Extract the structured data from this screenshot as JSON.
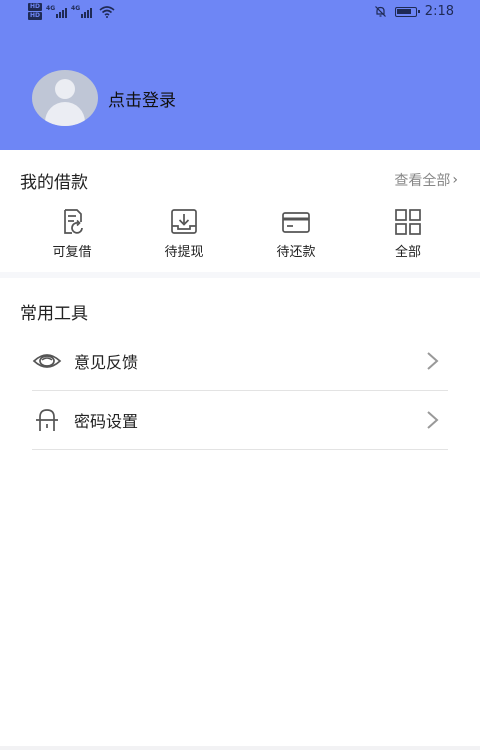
{
  "status_bar": {
    "badges": [
      "HD",
      "HD"
    ],
    "network": [
      "4G",
      "4G"
    ],
    "time": "2:18"
  },
  "profile": {
    "login_text": "点击登录"
  },
  "loans": {
    "title": "我的借款",
    "view_all": "查看全部",
    "items": [
      {
        "label": "可复借",
        "icon": "refresh-document-icon"
      },
      {
        "label": "待提现",
        "icon": "download-tray-icon"
      },
      {
        "label": "待还款",
        "icon": "card-icon"
      },
      {
        "label": "全部",
        "icon": "grid-icon"
      }
    ]
  },
  "tools": {
    "title": "常用工具",
    "items": [
      {
        "label": "意见反馈",
        "icon": "eye-icon"
      },
      {
        "label": "密码设置",
        "icon": "lock-icon"
      }
    ]
  },
  "colors": {
    "header_bg": "#6e86f5",
    "icon_color": "#555555"
  }
}
